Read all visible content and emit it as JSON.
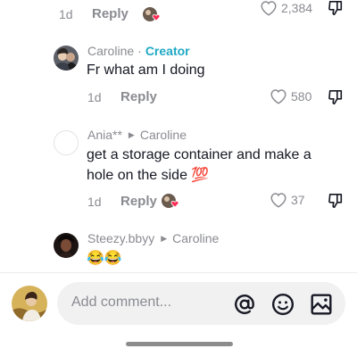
{
  "top_comment": {
    "time": "1d",
    "reply_label": "Reply",
    "like_count": "2,384"
  },
  "comments": [
    {
      "username": "Caroline",
      "badge": "Creator",
      "text": "Fr what am I doing",
      "time": "1d",
      "reply_label": "Reply",
      "like_count": "580"
    },
    {
      "username": "Ania**",
      "reply_to": "Caroline",
      "text_line1": "get a storage container and make a",
      "text_line2": "hole on the side 💯",
      "time": "1d",
      "reply_label": "Reply",
      "like_count": "37"
    },
    {
      "username": "Steezy.bbyy",
      "reply_to": "Caroline",
      "text": "😂😂"
    }
  ],
  "composer": {
    "placeholder": "Add comment...",
    "icons": [
      "at-icon",
      "emoji-icon",
      "image-icon"
    ]
  },
  "colors": {
    "creator_badge": "#20a9c4",
    "muted_text": "#8a8b91",
    "input_bg": "#f1f1f2",
    "heart_badge": "#fe2c55"
  }
}
